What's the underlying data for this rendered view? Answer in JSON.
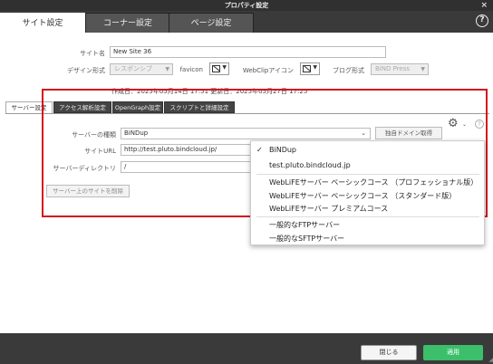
{
  "window": {
    "title": "プロパティ設定"
  },
  "main_tabs": [
    {
      "label": "サイト設定"
    },
    {
      "label": "コーナー設定"
    },
    {
      "label": "ページ設定"
    }
  ],
  "help_icon": "?",
  "site": {
    "name_label": "サイト名",
    "name_value": "New Site 36",
    "design_label": "デザイン形式",
    "design_value": "レスポンシブ",
    "favicon_label": "favicon",
    "webclip_label": "WebClipアイコン",
    "blog_label": "ブログ形式",
    "blog_value": "BiND Press",
    "dates": "作成日：2025年05月14日 17:51 更新日：2025年05月27日 17:25"
  },
  "sub_tabs": [
    {
      "label": "サーバー設定"
    },
    {
      "label": "アクセス解析設定"
    },
    {
      "label": "OpenGraph設定"
    },
    {
      "label": "スクリプトと詳細設定"
    }
  ],
  "server": {
    "type_label": "サーバーの種類",
    "type_value": "BiNDup",
    "domain_button": "独自ドメイン取得",
    "url_label": "サイトURL",
    "url_value": "http://test.pluto.bindcloud.jp/",
    "dir_label": "サーバーディレクトリ",
    "dir_value": "/",
    "delete_button": "サーバー上のサイトを削除",
    "help_icon": "?"
  },
  "dropdown": {
    "check": "✓",
    "items": [
      "BiNDup",
      "test.pluto.bindcloud.jp",
      "WebLiFEサーバー ベーシックコース （プロフェッショナル版）",
      "WebLiFEサーバー ベーシックコース （スタンダード版）",
      "WebLiFEサーバー プレミアムコース",
      "一般的なFTPサーバー",
      "一般的なSFTPサーバー"
    ]
  },
  "footer": {
    "close_label": "閉じる",
    "apply_label": "適用"
  },
  "colors": {
    "accent_green": "#3bbf6a",
    "highlight_red": "#d4141e",
    "chrome_dark": "#3a3a3a"
  }
}
